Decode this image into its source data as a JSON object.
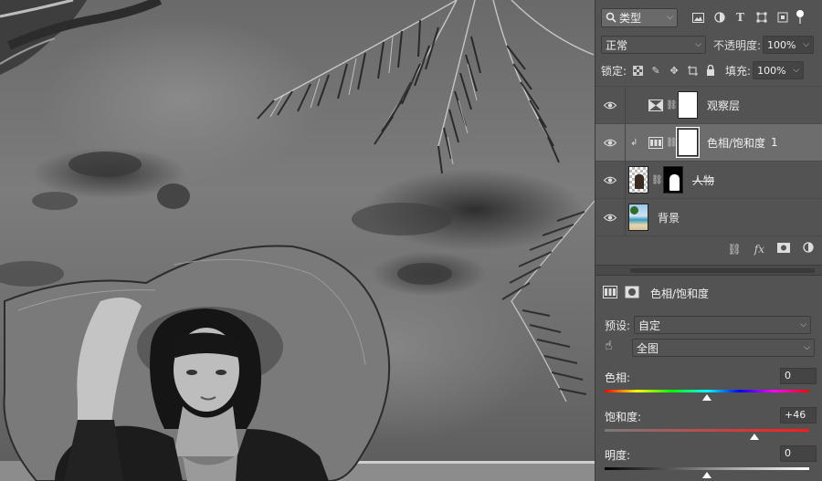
{
  "layers_panel": {
    "filter_kind": "类型",
    "blend_mode": "正常",
    "opacity_label": "不透明度:",
    "opacity_value": "100%",
    "lock_label": "锁定:",
    "fill_label": "填充:",
    "fill_value": "100%",
    "layers": [
      {
        "name": "观察层",
        "suffix": "",
        "type": "adjustment",
        "selected": false,
        "struck": false,
        "visible": true
      },
      {
        "name": "色相/饱和度",
        "suffix": "1",
        "type": "hue-saturation",
        "selected": true,
        "struck": false,
        "visible": true,
        "clipped": true
      },
      {
        "name": "人物",
        "suffix": "",
        "type": "pixel-with-mask",
        "selected": false,
        "struck": true,
        "visible": true
      },
      {
        "name": "背景",
        "suffix": "",
        "type": "background",
        "selected": false,
        "struck": false,
        "visible": true
      }
    ],
    "footer_icons": [
      "link-icon",
      "fx-icon",
      "add-mask-icon",
      "adjustment-icon"
    ]
  },
  "properties_panel": {
    "title": "色相/饱和度",
    "preset_label": "预设:",
    "preset_value": "自定",
    "channel_value": "全图",
    "hue": {
      "label": "色相:",
      "value": "0",
      "position": 0.5
    },
    "saturation": {
      "label": "饱和度:",
      "value": "+46",
      "position": 0.73
    },
    "lightness": {
      "label": "明度:",
      "value": "0",
      "position": 0.5
    }
  },
  "colors": {
    "panel_bg": "#535353",
    "selected_row": "#6d6d6d"
  }
}
